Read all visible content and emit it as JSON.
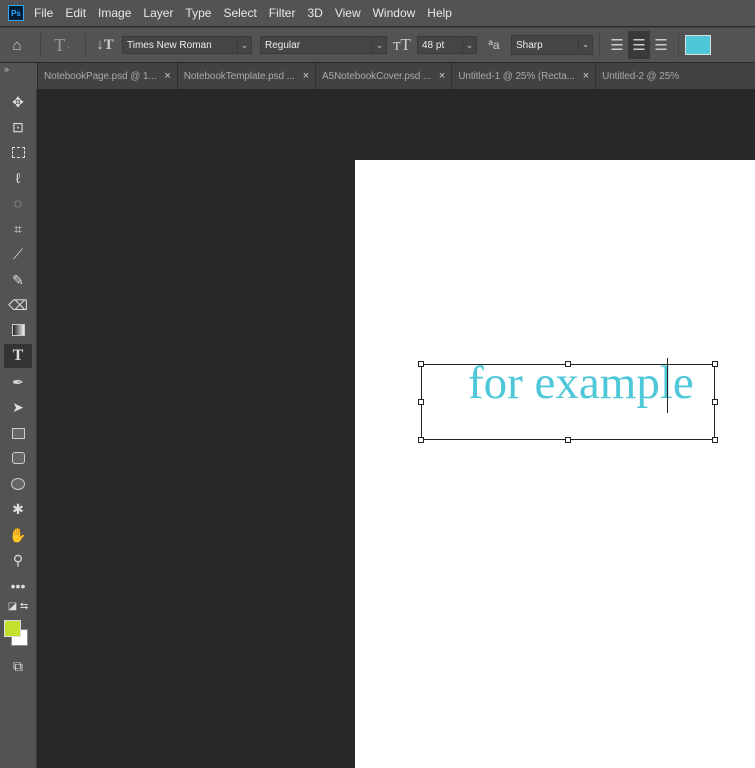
{
  "app": {
    "logo": "Ps"
  },
  "menu": [
    "File",
    "Edit",
    "Image",
    "Layer",
    "Type",
    "Select",
    "Filter",
    "3D",
    "View",
    "Window",
    "Help"
  ],
  "options": {
    "font_family": "Times New Roman",
    "font_style": "Regular",
    "font_size": "48 pt",
    "antialias": "Sharp",
    "text_color": "#4ec8d8",
    "align_active": "center"
  },
  "tabs": [
    {
      "label": "NotebookPage.psd @ 1..."
    },
    {
      "label": "NotebookTemplate.psd ..."
    },
    {
      "label": "A5NotebookCover.psd ..."
    },
    {
      "label": "Untitled-1 @ 25% (Recta..."
    },
    {
      "label": "Untitled-2 @ 25%"
    }
  ],
  "canvas": {
    "text": "for example"
  },
  "colors": {
    "foreground": "#c3e02c",
    "background": "#ffffff"
  }
}
